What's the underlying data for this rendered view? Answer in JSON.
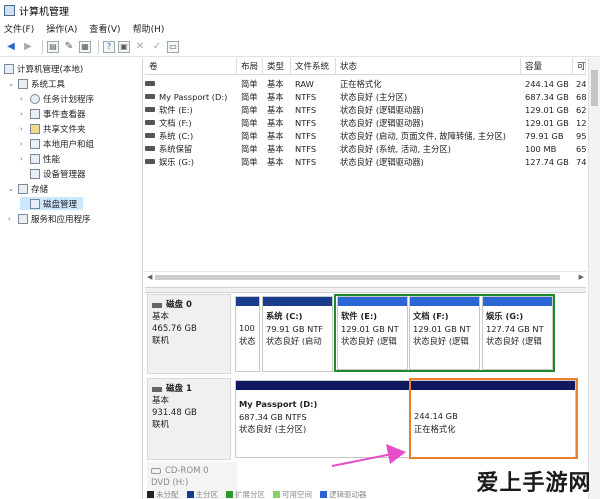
{
  "window": {
    "title": "计算机管理"
  },
  "menu": [
    "文件(F)",
    "操作(A)",
    "查看(V)",
    "帮助(H)"
  ],
  "colors": {
    "primary_partition": "#1b3b8c",
    "logical_drive": "#2a65d4",
    "unallocated": "#101860",
    "highlight_green": "#1e8a2a",
    "highlight_orange": "#e8812c",
    "annotation_arrow": "#e64ec8"
  },
  "tree": [
    {
      "label": "计算机管理(本地)",
      "icon": "computer-management-icon"
    },
    {
      "label": "系统工具",
      "icon": "system-tools-icon"
    },
    {
      "label": "任务计划程序",
      "icon": "clock-icon"
    },
    {
      "label": "事件查看器",
      "icon": "event-viewer-icon"
    },
    {
      "label": "共享文件夹",
      "icon": "shared-folder-icon"
    },
    {
      "label": "本地用户和组",
      "icon": "users-icon"
    },
    {
      "label": "性能",
      "icon": "performance-icon"
    },
    {
      "label": "设备管理器",
      "icon": "device-manager-icon"
    },
    {
      "label": "存储",
      "icon": "storage-icon"
    },
    {
      "label": "磁盘管理",
      "icon": "disk-management-icon"
    },
    {
      "label": "服务和应用程序",
      "icon": "services-icon"
    }
  ],
  "volumes": {
    "columns": [
      "卷",
      "布局",
      "类型",
      "文件系统",
      "状态",
      "容量",
      "可"
    ],
    "rows": [
      {
        "name": "",
        "layout": "简单",
        "type": "基本",
        "fs": "RAW",
        "status": "正在格式化",
        "capacity": "244.14 GB",
        "free": "24"
      },
      {
        "name": "My Passport (D:)",
        "layout": "简单",
        "type": "基本",
        "fs": "NTFS",
        "status": "状态良好 (主分区)",
        "capacity": "687.34 GB",
        "free": "68"
      },
      {
        "name": "软件 (E:)",
        "layout": "简单",
        "type": "基本",
        "fs": "NTFS",
        "status": "状态良好 (逻辑驱动器)",
        "capacity": "129.01 GB",
        "free": "62"
      },
      {
        "name": "文档 (F:)",
        "layout": "简单",
        "type": "基本",
        "fs": "NTFS",
        "status": "状态良好 (逻辑驱动器)",
        "capacity": "129.01 GB",
        "free": "12"
      },
      {
        "name": "系统 (C:)",
        "layout": "简单",
        "type": "基本",
        "fs": "NTFS",
        "status": "状态良好 (启动, 页面文件, 故障转储, 主分区)",
        "capacity": "79.91 GB",
        "free": "95"
      },
      {
        "name": "系统保留",
        "layout": "简单",
        "type": "基本",
        "fs": "NTFS",
        "status": "状态良好 (系统, 活动, 主分区)",
        "capacity": "100 MB",
        "free": "65"
      },
      {
        "name": "娱乐 (G:)",
        "layout": "简单",
        "type": "基本",
        "fs": "NTFS",
        "status": "状态良好 (逻辑驱动器)",
        "capacity": "127.74 GB",
        "free": "74"
      }
    ]
  },
  "disk0": {
    "name": "磁盘 0",
    "kind": "基本",
    "size": "465.76 GB",
    "state": "联机",
    "partitions": [
      {
        "line1": "100",
        "line2": "状态"
      },
      {
        "title": "系统 (C:)",
        "line1": "79.91 GB NTF",
        "line2": "状态良好 (启动"
      },
      {
        "title": "软件 (E:)",
        "line1": "129.01 GB NT",
        "line2": "状态良好 (逻辑"
      },
      {
        "title": "文档 (F:)",
        "line1": "129.01 GB NT",
        "line2": "状态良好 (逻辑"
      },
      {
        "title": "娱乐 (G:)",
        "line1": "127.74 GB NT",
        "line2": "状态良好 (逻辑"
      }
    ]
  },
  "disk1": {
    "name": "磁盘 1",
    "kind": "基本",
    "size": "931.48 GB",
    "state": "联机",
    "partitions": [
      {
        "title": "My Passport (D:)",
        "line1": "687.34 GB NTFS",
        "line2": "状态良好 (主分区)"
      },
      {
        "line1": "244.14 GB",
        "line2": "正在格式化"
      }
    ]
  },
  "cdrom": {
    "name": "CD-ROM 0",
    "drive": "DVD (H:)"
  },
  "legend": [
    "未分配",
    "主分区",
    "扩展分区",
    "可用空间",
    "逻辑驱动器"
  ],
  "watermark": "爱上手游网"
}
